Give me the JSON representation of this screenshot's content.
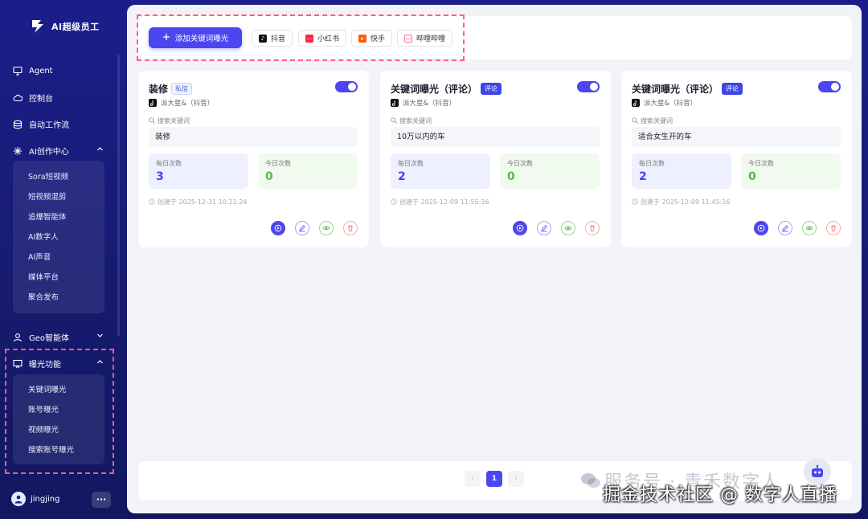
{
  "brand": {
    "name": "AI超级员工"
  },
  "sidebar": {
    "items": [
      {
        "label": "Agent",
        "icon": "monitor-icon"
      },
      {
        "label": "控制台",
        "icon": "cloud-icon"
      },
      {
        "label": "自动工作流",
        "icon": "workflow-icon"
      },
      {
        "label": "AI创作中心",
        "icon": "sparkle-icon",
        "expanded": true
      },
      {
        "label": "Geo智能体",
        "icon": "user-icon",
        "expanded": false
      },
      {
        "label": "曝光功能",
        "icon": "presentation-icon",
        "expanded": true
      }
    ],
    "ai_creation_sub": [
      "Sora短视频",
      "短视频混剪",
      "追爆智能体",
      "AI数字人",
      "AI声音",
      "媒体平台",
      "聚合发布"
    ],
    "exposure_sub": [
      "关键词曝光",
      "账号曝光",
      "视频曝光",
      "搜索账号曝光"
    ]
  },
  "user": {
    "name": "jingjing",
    "more_label": "···"
  },
  "toolbar": {
    "add_label": "添加关键词曝光",
    "platforms": [
      {
        "label": "抖音",
        "color": "#111111"
      },
      {
        "label": "小红书",
        "color": "#ff2442"
      },
      {
        "label": "快手",
        "color": "#ff5a00"
      },
      {
        "label": "哔哩哔哩",
        "color": "#fb7299"
      }
    ]
  },
  "cards": [
    {
      "title": "装修",
      "tag": "私信",
      "account": "派大星&（抖音）",
      "keyword_label": "搜索关键词",
      "keyword": "装修",
      "daily_label": "每日次数",
      "daily": "3",
      "today_label": "今日次数",
      "today": "0",
      "created": "创建于 2025-12-31 10:21:24",
      "enabled": true
    },
    {
      "title": "关键词曝光（评论）",
      "tag": "评论",
      "account": "派大星&（抖音）",
      "keyword_label": "搜索关键词",
      "keyword": "10万以内的车",
      "daily_label": "每日次数",
      "daily": "2",
      "today_label": "今日次数",
      "today": "0",
      "created": "创建于 2025-12-09 11:55:16",
      "enabled": true
    },
    {
      "title": "关键词曝光（评论）",
      "tag": "评论",
      "account": "派大星&（抖音）",
      "keyword_label": "搜索关键词",
      "keyword": "适合女生开的车",
      "daily_label": "每日次数",
      "daily": "2",
      "today_label": "今日次数",
      "today": "0",
      "created": "创建于 2025-12-09 11:45:16",
      "enabled": true
    }
  ],
  "pagination": {
    "current": "1",
    "prev": "‹",
    "next": "›"
  },
  "watermark": {
    "line1": "服务号 · 青禾数字人",
    "line2": "掘金技术社区 @ 数字人直播"
  },
  "colors": {
    "accent": "#4b46f0",
    "sidebar_bg": "#1b1e8a",
    "highlight_dash": "#ff5a86",
    "success": "#55b84a"
  }
}
